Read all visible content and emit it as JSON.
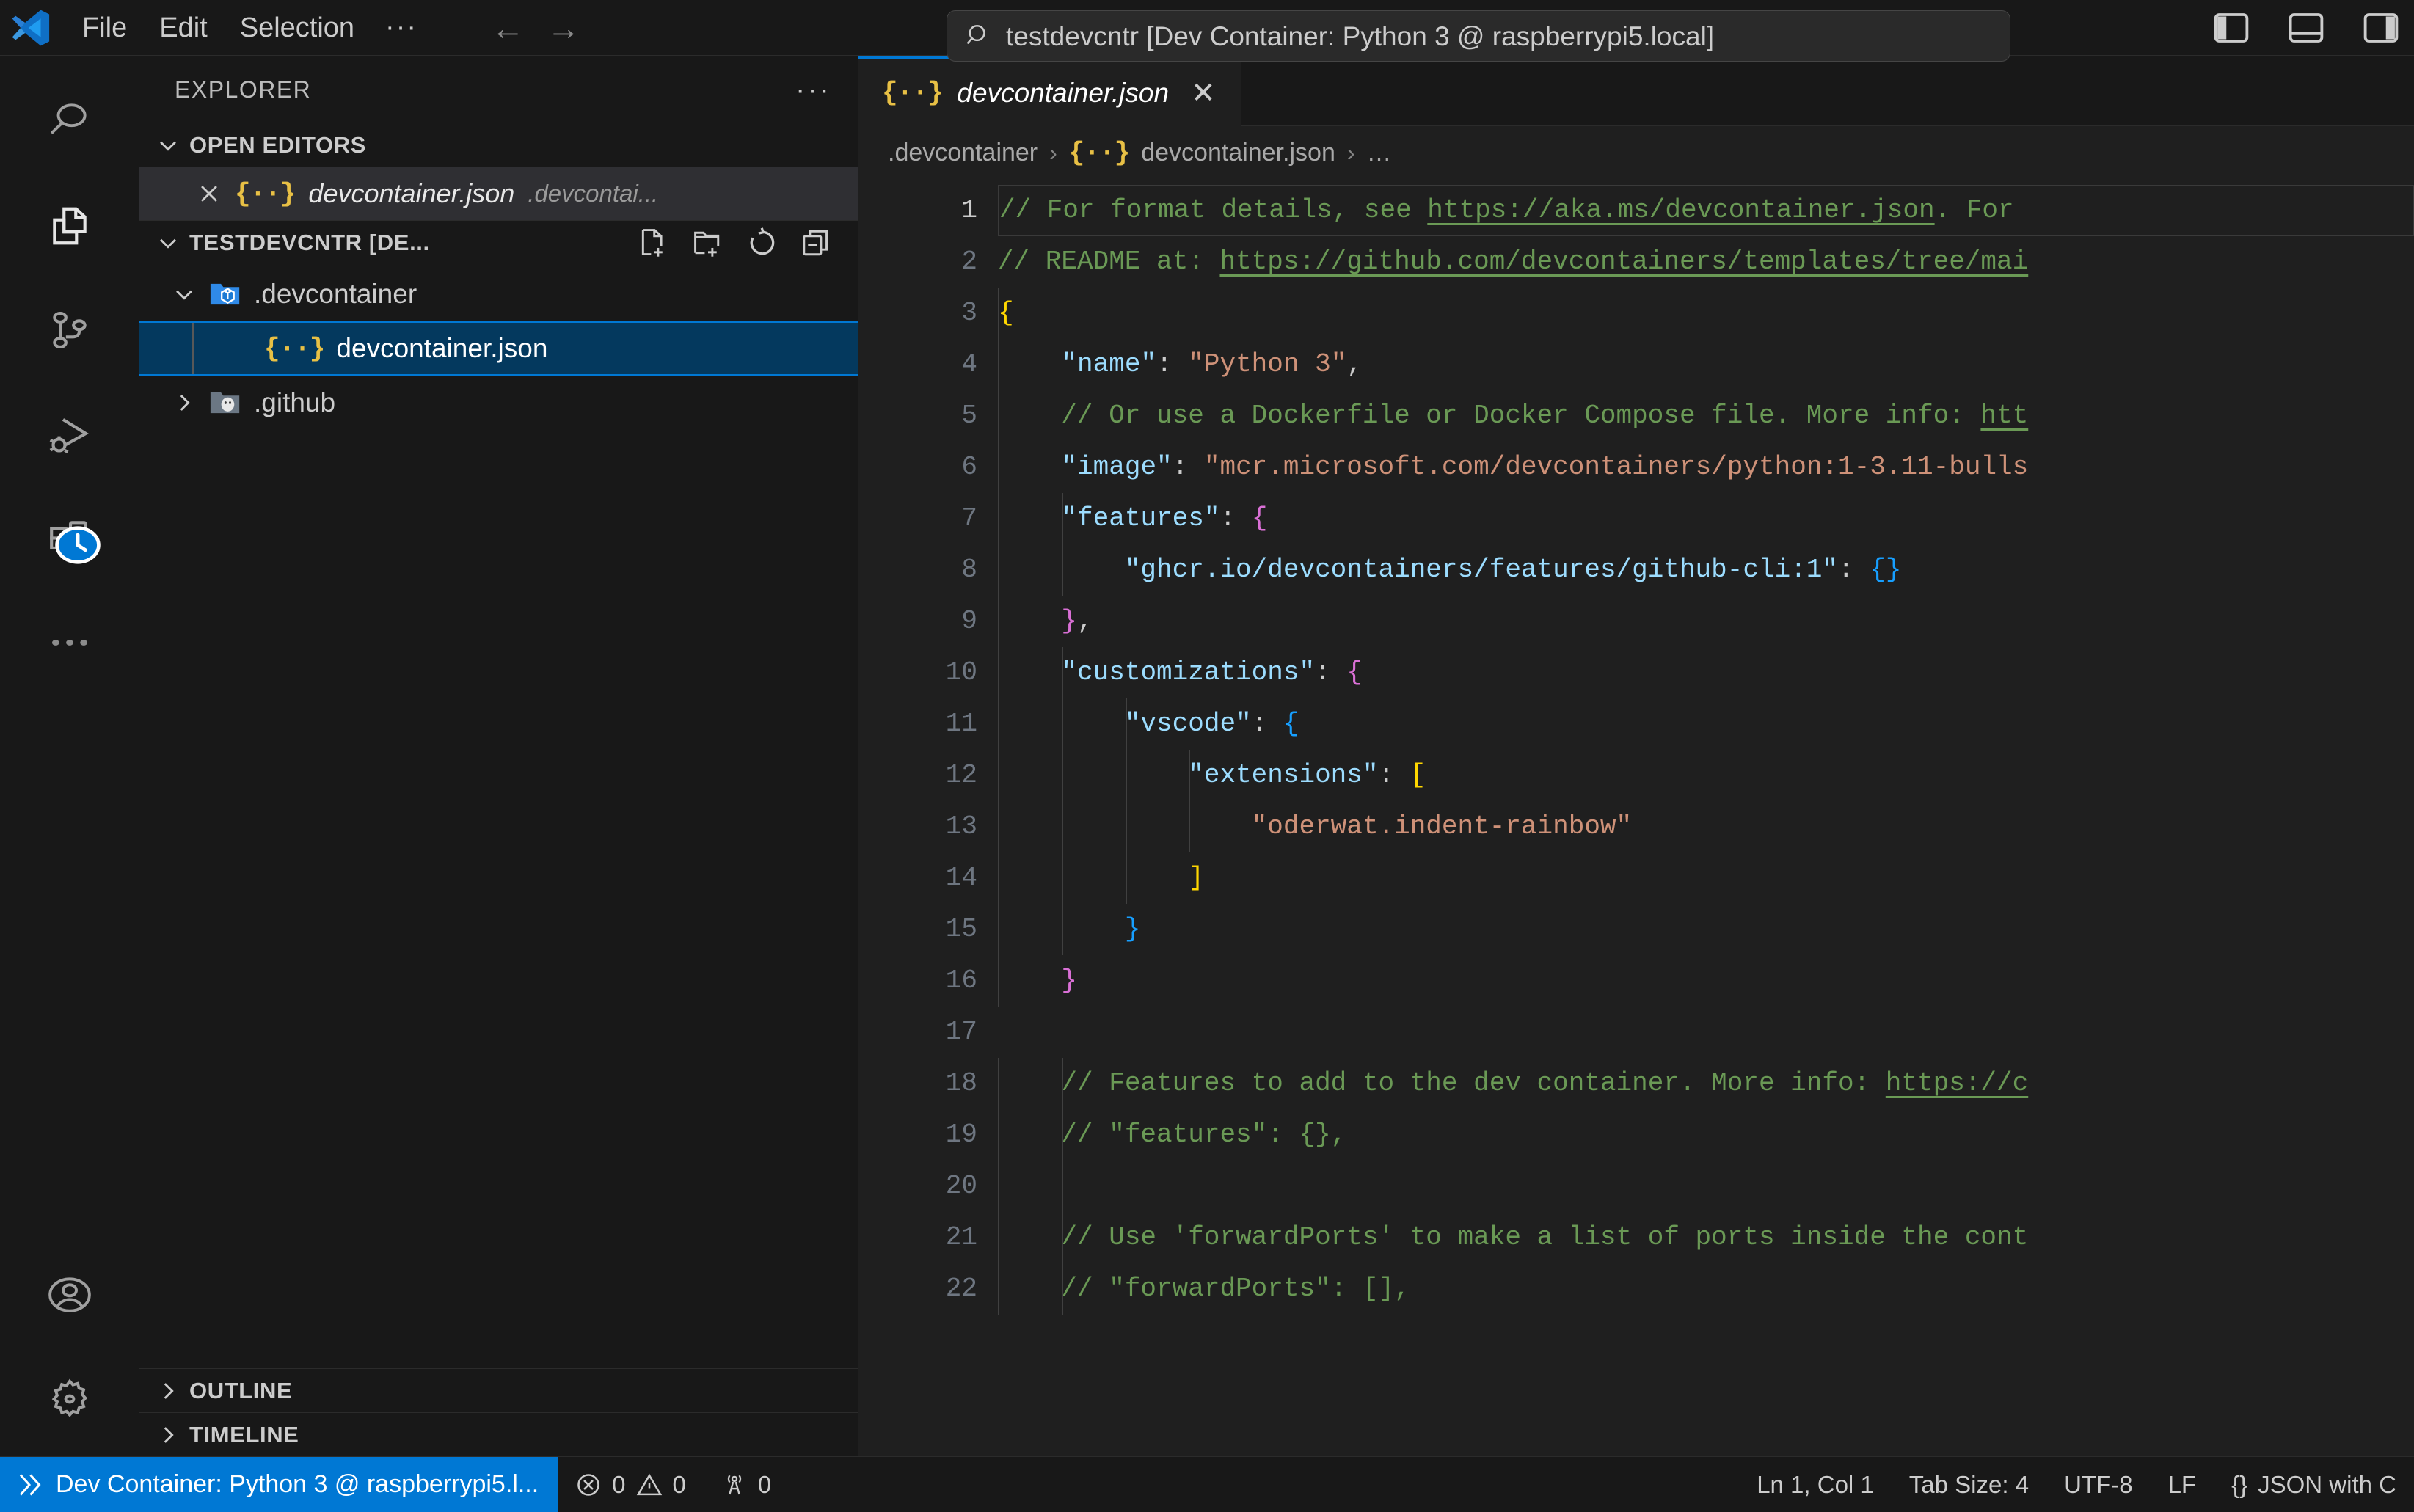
{
  "titlebar": {
    "logo_name": "vscode-logo",
    "menus": [
      "File",
      "Edit",
      "Selection"
    ],
    "overflow_label": "···",
    "back_label": "←",
    "forward_label": "→",
    "quick_input": {
      "icon": "search-icon",
      "value": "testdevcntr [Dev Container: Python 3 @ raspberrypi5.local]",
      "placeholder": "Search"
    },
    "layout_icons": [
      "toggle-primary-sidebar-icon",
      "toggle-panel-icon",
      "toggle-secondary-sidebar-icon"
    ]
  },
  "activitybar": {
    "top_items": [
      {
        "name": "search-icon",
        "label": "Search"
      },
      {
        "name": "source-control-copy-icon",
        "label": "Explorer"
      },
      {
        "name": "source-control-icon",
        "label": "Source Control"
      },
      {
        "name": "run-and-debug-icon",
        "label": "Run and Debug"
      },
      {
        "name": "extensions-icon",
        "label": "Extensions"
      },
      {
        "name": "more-actions-icon",
        "label": "Additional Views"
      }
    ],
    "bottom_items": [
      {
        "name": "accounts-icon",
        "label": "Accounts"
      },
      {
        "name": "settings-gear-icon",
        "label": "Manage"
      }
    ]
  },
  "sidebar": {
    "title": "EXPLORER",
    "more_actions": "···",
    "open_editors": {
      "title": "OPEN EDITORS",
      "rows": [
        {
          "close": "✕",
          "icon": "{··}",
          "name": "devcontainer.json",
          "path": ".devcontai..."
        }
      ]
    },
    "workspace": {
      "title": "TESTDEVCNTR [DE...",
      "actions": [
        "new-file-icon",
        "new-folder-icon",
        "refresh-explorer-icon",
        "collapse-folders-icon"
      ],
      "tree": [
        {
          "label": ".devcontainer",
          "icon": "devcontainer-folder-icon",
          "expanded": true,
          "depth": 1,
          "selected": false
        },
        {
          "label": "devcontainer.json",
          "icon": "json-file-icon",
          "expanded": null,
          "depth": 2,
          "selected": true
        },
        {
          "label": ".github",
          "icon": "github-folder-icon",
          "expanded": false,
          "depth": 1,
          "selected": false
        }
      ]
    },
    "outline": {
      "title": "OUTLINE"
    },
    "timeline": {
      "title": "TIMELINE"
    }
  },
  "editor": {
    "tab": {
      "icon": "{··}",
      "name": "devcontainer.json",
      "close": "✕",
      "dirty": false
    },
    "breadcrumbs": [
      {
        "text": ".devcontainer",
        "icon": null
      },
      {
        "text": "devcontainer.json",
        "icon": "{··}"
      },
      {
        "text": "…",
        "icon": null
      }
    ],
    "breadcrumb_separator": "›",
    "language": "JSON with Comments",
    "lines": [
      {
        "n": 1,
        "tokens": [
          {
            "t": "// For format details, see ",
            "c": "tok-c"
          },
          {
            "t": "https://aka.ms/devcontainer.json",
            "c": "tok-l"
          },
          {
            "t": ". For",
            "c": "tok-c"
          }
        ]
      },
      {
        "n": 2,
        "tokens": [
          {
            "t": "// README at: ",
            "c": "tok-c"
          },
          {
            "t": "https://github.com/devcontainers/templates/tree/mai",
            "c": "tok-l"
          }
        ]
      },
      {
        "n": 3,
        "tokens": [
          {
            "t": "{",
            "c": "tok-b1"
          }
        ]
      },
      {
        "n": 4,
        "tokens": [
          {
            "t": "    ",
            "c": "tok-p"
          },
          {
            "t": "\"name\"",
            "c": "tok-k"
          },
          {
            "t": ": ",
            "c": "tok-p"
          },
          {
            "t": "\"Python 3\"",
            "c": "tok-s"
          },
          {
            "t": ",",
            "c": "tok-p"
          }
        ]
      },
      {
        "n": 5,
        "tokens": [
          {
            "t": "    // Or use a Dockerfile or Docker Compose file. More info: ",
            "c": "tok-c"
          },
          {
            "t": "htt",
            "c": "tok-l"
          }
        ]
      },
      {
        "n": 6,
        "tokens": [
          {
            "t": "    ",
            "c": "tok-p"
          },
          {
            "t": "\"image\"",
            "c": "tok-k"
          },
          {
            "t": ": ",
            "c": "tok-p"
          },
          {
            "t": "\"mcr.microsoft.com/devcontainers/python:1-3.11-bulls",
            "c": "tok-s"
          }
        ]
      },
      {
        "n": 7,
        "tokens": [
          {
            "t": "    ",
            "c": "tok-p"
          },
          {
            "t": "\"features\"",
            "c": "tok-k"
          },
          {
            "t": ": ",
            "c": "tok-p"
          },
          {
            "t": "{",
            "c": "tok-b2"
          }
        ]
      },
      {
        "n": 8,
        "tokens": [
          {
            "t": "        ",
            "c": "tok-p"
          },
          {
            "t": "\"ghcr.io/devcontainers/features/github-cli:1\"",
            "c": "tok-k"
          },
          {
            "t": ": ",
            "c": "tok-p"
          },
          {
            "t": "{}",
            "c": "tok-b3"
          }
        ]
      },
      {
        "n": 9,
        "tokens": [
          {
            "t": "    ",
            "c": "tok-p"
          },
          {
            "t": "}",
            "c": "tok-b2"
          },
          {
            "t": ",",
            "c": "tok-p"
          }
        ]
      },
      {
        "n": 10,
        "tokens": [
          {
            "t": "    ",
            "c": "tok-p"
          },
          {
            "t": "\"customizations\"",
            "c": "tok-k"
          },
          {
            "t": ": ",
            "c": "tok-p"
          },
          {
            "t": "{",
            "c": "tok-b2"
          }
        ]
      },
      {
        "n": 11,
        "tokens": [
          {
            "t": "        ",
            "c": "tok-p"
          },
          {
            "t": "\"vscode\"",
            "c": "tok-k"
          },
          {
            "t": ": ",
            "c": "tok-p"
          },
          {
            "t": "{",
            "c": "tok-b3"
          }
        ]
      },
      {
        "n": 12,
        "tokens": [
          {
            "t": "            ",
            "c": "tok-p"
          },
          {
            "t": "\"extensions\"",
            "c": "tok-k"
          },
          {
            "t": ": ",
            "c": "tok-p"
          },
          {
            "t": "[",
            "c": "tok-b1"
          }
        ]
      },
      {
        "n": 13,
        "tokens": [
          {
            "t": "                ",
            "c": "tok-p"
          },
          {
            "t": "\"oderwat.indent-rainbow\"",
            "c": "tok-s"
          }
        ]
      },
      {
        "n": 14,
        "tokens": [
          {
            "t": "            ",
            "c": "tok-p"
          },
          {
            "t": "]",
            "c": "tok-b1"
          }
        ]
      },
      {
        "n": 15,
        "tokens": [
          {
            "t": "        ",
            "c": "tok-p"
          },
          {
            "t": "}",
            "c": "tok-b3"
          }
        ]
      },
      {
        "n": 16,
        "tokens": [
          {
            "t": "    ",
            "c": "tok-p"
          },
          {
            "t": "}",
            "c": "tok-b2"
          }
        ]
      },
      {
        "n": 17,
        "tokens": []
      },
      {
        "n": 18,
        "tokens": [
          {
            "t": "    // Features to add to the dev container. More info: ",
            "c": "tok-c"
          },
          {
            "t": "https://c",
            "c": "tok-l"
          }
        ]
      },
      {
        "n": 19,
        "tokens": [
          {
            "t": "    // \"features\": {},",
            "c": "tok-c"
          }
        ]
      },
      {
        "n": 20,
        "tokens": []
      },
      {
        "n": 21,
        "tokens": [
          {
            "t": "    // Use 'forwardPorts' to make a list of ports inside the cont",
            "c": "tok-c"
          }
        ]
      },
      {
        "n": 22,
        "tokens": [
          {
            "t": "    // \"forwardPorts\": [],",
            "c": "tok-c"
          }
        ]
      }
    ]
  },
  "statusbar": {
    "remote": {
      "icon": "remote-indicator-icon",
      "text": "Dev Container: Python 3 @ raspberrypi5.l..."
    },
    "problems": {
      "errors_icon": "error-icon",
      "errors": "0",
      "warnings_icon": "warning-icon",
      "warnings": "0"
    },
    "ports": {
      "icon": "radio-tower-icon",
      "count": "0"
    },
    "cursor_position": "Ln 1, Col 1",
    "tab_size": "Tab Size: 4",
    "encoding": "UTF-8",
    "eol": "LF",
    "language_icon": "{}",
    "language": "JSON with C"
  },
  "colors": {
    "accent": "#0078d4",
    "titlebar_bg": "#181818",
    "editor_bg": "#1f1f1f",
    "sidebar_bg": "#181818",
    "selection_bg": "#04395e",
    "comment": "#6a9955",
    "string": "#ce9178",
    "key": "#9cdcfe",
    "bracket1": "#ffd700",
    "bracket2": "#da70d6",
    "bracket3": "#179fff"
  }
}
